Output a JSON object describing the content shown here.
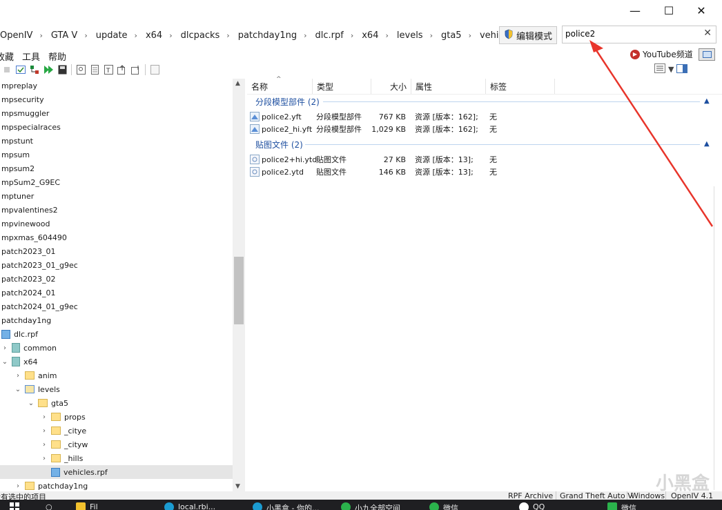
{
  "window": {
    "minimize_glyph": "—",
    "maximize_glyph": "☐",
    "close_glyph": "✕"
  },
  "address": {
    "crumbs": [
      "OpenIV",
      "GTA V",
      "update",
      "x64",
      "dlcpacks",
      "patchday1ng",
      "dlc.rpf",
      "x64",
      "levels",
      "gta5",
      "vehicles.rpf"
    ],
    "separator": "›",
    "edit_mode_label": "编辑模式"
  },
  "search": {
    "value": "police2",
    "clear_glyph": "✕"
  },
  "menu": {
    "items": [
      "收藏",
      "工具",
      "帮助"
    ]
  },
  "youtube": {
    "label": "YouTube频道",
    "icon": "▶"
  },
  "tree": {
    "items": [
      {
        "label": "mpreplay"
      },
      {
        "label": "mpsecurity"
      },
      {
        "label": "mpsmuggler"
      },
      {
        "label": "mpspecialraces"
      },
      {
        "label": "mpstunt"
      },
      {
        "label": "mpsum"
      },
      {
        "label": "mpsum2"
      },
      {
        "label": "mpSum2_G9EC"
      },
      {
        "label": "mptuner"
      },
      {
        "label": "mpvalentines2"
      },
      {
        "label": "mpvinewood"
      },
      {
        "label": "mpxmas_604490"
      },
      {
        "label": "patch2023_01"
      },
      {
        "label": "patch2023_01_g9ec"
      },
      {
        "label": "patch2023_02"
      },
      {
        "label": "patch2024_01"
      },
      {
        "label": "patch2024_01_g9ec"
      },
      {
        "label": "patchday1ng"
      },
      {
        "label": "dlc.rpf"
      },
      {
        "label": "common"
      },
      {
        "label": "x64"
      },
      {
        "label": "anim"
      },
      {
        "label": "levels"
      },
      {
        "label": "gta5"
      },
      {
        "label": "props"
      },
      {
        "label": "_citye"
      },
      {
        "label": "_cityw"
      },
      {
        "label": "_hills"
      },
      {
        "label": "vehicles.rpf"
      },
      {
        "label": "patchday1ng"
      }
    ]
  },
  "list": {
    "columns": [
      "名称",
      "类型",
      "大小",
      "属性",
      "标签"
    ],
    "groups": [
      {
        "title": "分段模型部件 (2)",
        "files": [
          {
            "name": "police2.yft",
            "type": "分段模型部件",
            "size": "767 KB",
            "attr": "资源 [版本：162];",
            "tag": "无"
          },
          {
            "name": "police2_hi.yft",
            "type": "分段模型部件",
            "size": "1,029 KB",
            "attr": "资源 [版本：162];",
            "tag": "无"
          }
        ]
      },
      {
        "title": "贴图文件 (2)",
        "files": [
          {
            "name": "police2+hi.ytd",
            "type": "贴图文件",
            "size": "27 KB",
            "attr": "资源 [版本：13];",
            "tag": "无"
          },
          {
            "name": "police2.ytd",
            "type": "贴图文件",
            "size": "146 KB",
            "attr": "资源 [版本：13];",
            "tag": "无"
          }
        ]
      }
    ]
  },
  "status": {
    "left": "没有选中的项目",
    "archive": "RPF Archive",
    "game": "Grand Theft Auto V",
    "platform": "Windows",
    "version": "OpenIV 4.1"
  },
  "taskbar": {
    "items": [
      "Fil",
      "local.rbi...",
      "小黑盒 - 你的...",
      "小九全部空间",
      "微信",
      "QQ",
      "微信"
    ]
  },
  "watermark": "小黑盒",
  "colors": {
    "accent_blue": "#1e4fa0",
    "arrow_red": "#e8352b",
    "selection": "#e5e5e5"
  }
}
